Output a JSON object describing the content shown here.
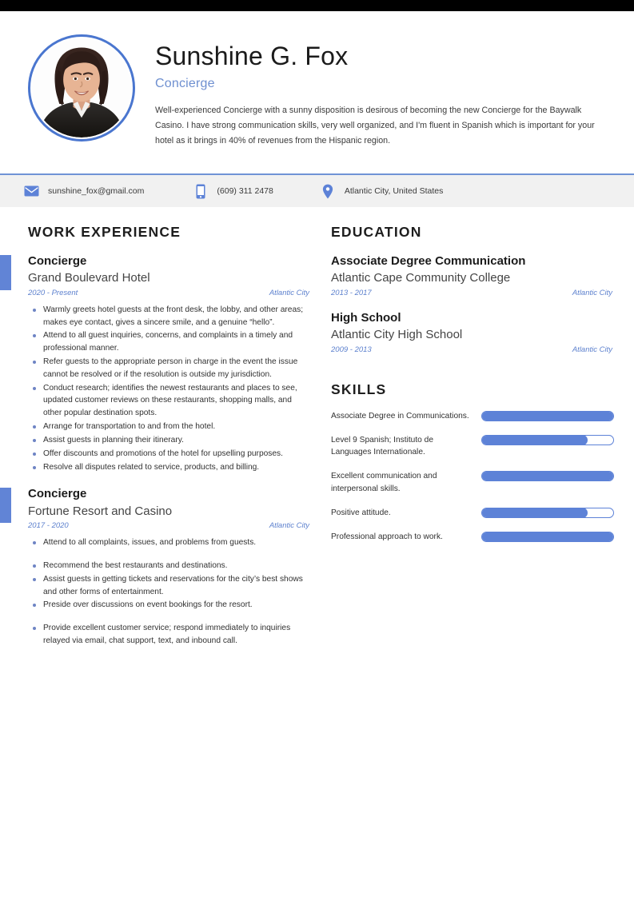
{
  "theme": {
    "accent_blue": "#5d82d7",
    "accent_blue_light": "#6e8fd0",
    "black_band": "#000000",
    "contact_bar_bg": "#f1f1f1"
  },
  "header": {
    "name": "Sunshine G. Fox",
    "role": "Concierge",
    "summary": "Well-experienced Concierge with a sunny disposition is desirous of becoming the new Concierge for the Baywalk Casino. I have strong communication skills, very well organized, and I'm fluent in Spanish which is important for your hotel as it brings in 40% of revenues from the Hispanic region.",
    "photo_alt": "profile-photo"
  },
  "contact": {
    "email": {
      "icon": "envelope-icon",
      "value": "sunshine_fox@gmail.com"
    },
    "phone": {
      "icon": "mobile-phone-icon",
      "value": "(609) 311 2478"
    },
    "location": {
      "icon": "map-pin-icon",
      "value": "Atlantic City, United States"
    }
  },
  "work_experience": {
    "title": "WORK EXPERIENCE",
    "jobs": [
      {
        "position": "Concierge",
        "employer": "Grand Boulevard Hotel",
        "dates": "2020 - Present",
        "location": "Atlantic City",
        "bullets": [
          {
            "text": "Warmly greets hotel guests at the front desk, the lobby, and other areas; makes eye contact, gives a sincere smile, and a genuine “hello”.",
            "gap": false
          },
          {
            "text": "Attend to all guest inquiries, concerns, and complaints in a timely and professional manner.",
            "gap": false
          },
          {
            "text": "Refer guests to the appropriate person in charge in the event the issue cannot be resolved or if the resolution is outside my jurisdiction.",
            "gap": false
          },
          {
            "text": "Conduct research; identifies the newest restaurants and places to see, updated customer reviews on these restaurants, shopping malls, and other popular destination spots.",
            "gap": false
          },
          {
            "text": "Arrange for transportation to and from the hotel.",
            "gap": false
          },
          {
            "text": "Assist guests in planning their itinerary.",
            "gap": false
          },
          {
            "text": "Offer discounts and promotions of the hotel for upselling purposes.",
            "gap": false
          },
          {
            "text": "Resolve all disputes related to service, products, and billing.",
            "gap": false
          }
        ]
      },
      {
        "position": "Concierge",
        "employer": "Fortune Resort and Casino",
        "dates": "2017 - 2020",
        "location": "Atlantic City",
        "bullets": [
          {
            "text": "Attend to all complaints, issues, and problems from guests.",
            "gap": false
          },
          {
            "text": "Recommend the best restaurants and destinations.",
            "gap": true
          },
          {
            "text": "Assist guests in getting tickets and reservations for the city’s best shows and other forms of entertainment.",
            "gap": false
          },
          {
            "text": "Preside over discussions on event bookings for the resort.",
            "gap": false
          },
          {
            "text": "Provide excellent customer service; respond immediately to inquiries relayed via email, chat support, text, and inbound call.",
            "gap": true
          }
        ]
      }
    ]
  },
  "education": {
    "title": "EDUCATION",
    "entries": [
      {
        "degree": "Associate Degree Communication",
        "school": "Atlantic Cape Community College",
        "dates": "2013 - 2017",
        "location": "Atlantic City"
      },
      {
        "degree": "High School",
        "school": "Atlantic City High School",
        "dates": "2009 - 2013",
        "location": "Atlantic City"
      }
    ]
  },
  "skills": {
    "title": "SKILLS",
    "items": [
      {
        "label": "Associate Degree in Communications.",
        "level": 100
      },
      {
        "label": "Level 9 Spanish; Instituto de Languages Internationale.",
        "level": 80
      },
      {
        "label": "Excellent communication and interpersonal skills.",
        "level": 100
      },
      {
        "label": "Positive attitude.",
        "level": 80
      },
      {
        "label": "Professional approach to work.",
        "level": 100
      }
    ]
  }
}
